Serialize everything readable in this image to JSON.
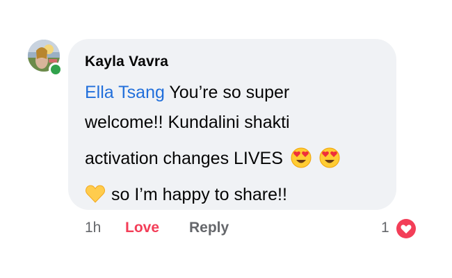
{
  "comment": {
    "author": "Kayla Vavra",
    "mention": "Ella Tsang",
    "lines": [
      " You’re so super",
      "welcome!! Kundalini shakti",
      "activation changes LIVES",
      "so I’m happy to share!!"
    ],
    "emojis": [
      "heart-eyes-emoji",
      "heart-eyes-emoji",
      "yellow-heart-emoji"
    ],
    "online_status_color": "#31a24c",
    "mention_color": "#216fdb"
  },
  "actions": {
    "timestamp": "1h",
    "love_label": "Love",
    "reply_label": "Reply",
    "love_color": "#f33e58"
  },
  "reactions": {
    "count": "1",
    "icon": "love-reaction-icon"
  }
}
